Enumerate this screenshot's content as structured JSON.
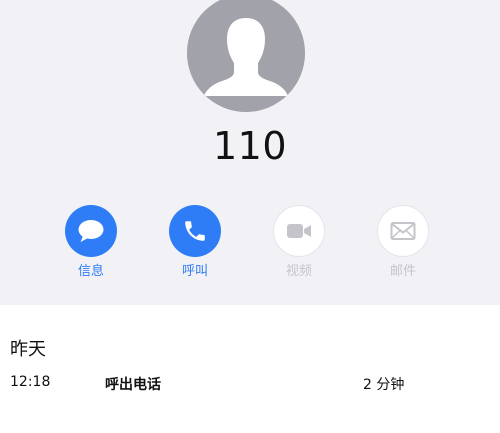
{
  "contact": {
    "number": "110"
  },
  "actions": [
    {
      "label": "信息",
      "icon": "message-bubble-icon",
      "enabled": true
    },
    {
      "label": "呼叫",
      "icon": "phone-icon",
      "enabled": true
    },
    {
      "label": "视频",
      "icon": "video-camera-icon",
      "enabled": false
    },
    {
      "label": "邮件",
      "icon": "envelope-icon",
      "enabled": false
    }
  ],
  "history": {
    "date": "昨天",
    "entries": [
      {
        "time": "12:18",
        "type": "呼出电话",
        "duration": "2 分钟"
      }
    ]
  },
  "colors": {
    "accent": "#2f7df6",
    "disabled": "#c4c4ca",
    "avatar_bg": "#a2a3aa",
    "page_bg": "#f2f2f6"
  }
}
